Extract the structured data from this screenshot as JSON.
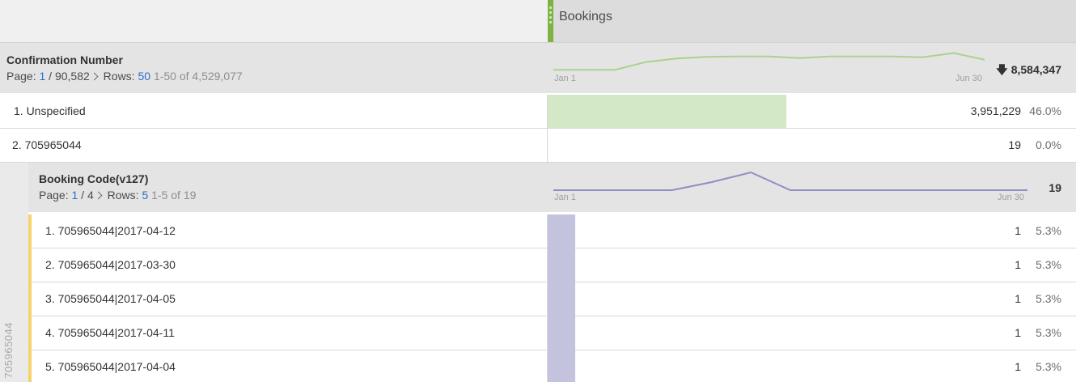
{
  "header": {
    "metric_title": "Bookings",
    "colors": {
      "grip": "#7cb342",
      "line_primary": "#a8d38c",
      "bar_primary": "#d3e8c7",
      "line_breakdown": "#8e8ec4",
      "bar_breakdown": "#c3c3de",
      "row_accent": "#f5d36b",
      "link": "#2d6ec9"
    }
  },
  "dimension": {
    "title": "Confirmation Number",
    "page_label": "Page:",
    "page_current": "1",
    "page_total": "/ 90,582",
    "rows_label": "Rows:",
    "rows_value": "50",
    "range": "1-50 of 4,529,077",
    "axis_start": "Jan 1",
    "axis_end": "Jun 30",
    "total": "8,584,347",
    "sort_icon": "arrow-down-icon",
    "trend": [
      0.18,
      0.18,
      0.18,
      0.55,
      0.72,
      0.8,
      0.82,
      0.82,
      0.74,
      0.82,
      0.82,
      0.82,
      0.78,
      0.98,
      0.66
    ]
  },
  "rows": [
    {
      "label": "1. Unspecified",
      "value": "3,951,229",
      "percent": "46.0%",
      "share": 0.46
    },
    {
      "label": "2. 705965044",
      "value": "19",
      "percent": "0.0%",
      "share": 0.0
    }
  ],
  "breakdown": {
    "parent_label": "705965044",
    "title": "Booking Code(v127)",
    "page_label": "Page:",
    "page_current": "1",
    "page_total": "/ 4",
    "rows_label": "Rows:",
    "rows_value": "5",
    "range": "1-5 of 19",
    "axis_start": "Jan 1",
    "axis_end": "Jun 30",
    "total": "19",
    "trend": [
      0,
      0,
      0,
      0,
      0.45,
      1,
      0,
      0,
      0,
      0,
      0,
      0,
      0
    ],
    "rows": [
      {
        "label": "1. 705965044|2017-04-12",
        "value": "1",
        "percent": "5.3%",
        "share": 0.053
      },
      {
        "label": "2. 705965044|2017-03-30",
        "value": "1",
        "percent": "5.3%",
        "share": 0.053
      },
      {
        "label": "3. 705965044|2017-04-05",
        "value": "1",
        "percent": "5.3%",
        "share": 0.053
      },
      {
        "label": "4. 705965044|2017-04-11",
        "value": "1",
        "percent": "5.3%",
        "share": 0.053
      },
      {
        "label": "5. 705965044|2017-04-04",
        "value": "1",
        "percent": "5.3%",
        "share": 0.053
      }
    ]
  }
}
